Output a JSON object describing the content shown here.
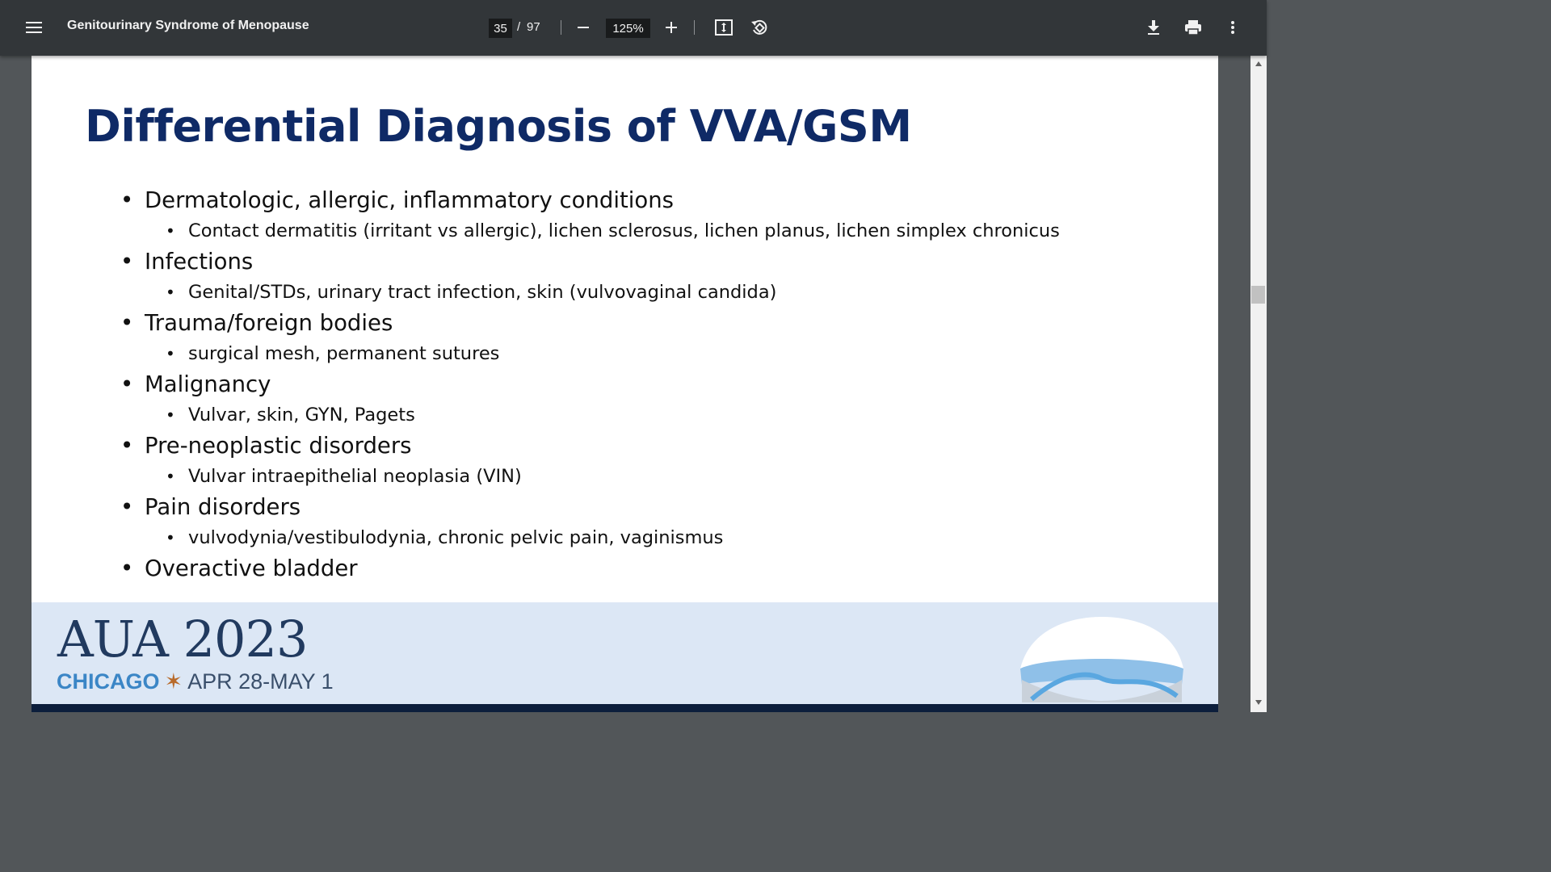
{
  "toolbar": {
    "menu_icon": "menu-icon",
    "title": "Genitourinary Syndrome of Menopause",
    "current_page": "35",
    "page_separator": "/",
    "total_pages": "97",
    "zoom": "125%",
    "icons": [
      "zoom-out-icon",
      "zoom-in-icon",
      "fit-page-icon",
      "rotate-icon",
      "download-icon",
      "print-icon",
      "more-options-icon"
    ]
  },
  "slide": {
    "title": "Differential Diagnosis of VVA/GSM",
    "items": [
      {
        "text": "Dermatologic, allergic, inflammatory conditions",
        "sub": "Contact dermatitis (irritant vs allergic), lichen sclerosus, lichen planus, lichen simplex chronicus"
      },
      {
        "text": "Infections",
        "sub": "Genital/STDs, urinary tract infection, skin (vulvovaginal candida)"
      },
      {
        "text": "Trauma/foreign bodies",
        "sub": "surgical mesh, permanent sutures"
      },
      {
        "text": "Malignancy",
        "sub": "Vulvar, skin, GYN, Pagets"
      },
      {
        "text": "Pre-neoplastic disorders",
        "sub": "Vulvar intraepithelial neoplasia (VIN)"
      },
      {
        "text": "Pain disorders",
        "sub": "vulvodynia/vestibulodynia, chronic pelvic pain, vaginismus"
      },
      {
        "text": "Overactive bladder",
        "sub": null
      }
    ],
    "footer": {
      "logo_text": "AUA 2023",
      "city": "CHICAGO",
      "dates": "APR 28-MAY 1"
    }
  },
  "colors": {
    "toolbar_bg": "#323639",
    "viewer_bg": "#525659",
    "title_blue": "#0f2a66",
    "footer_band": "#dce7f5"
  }
}
